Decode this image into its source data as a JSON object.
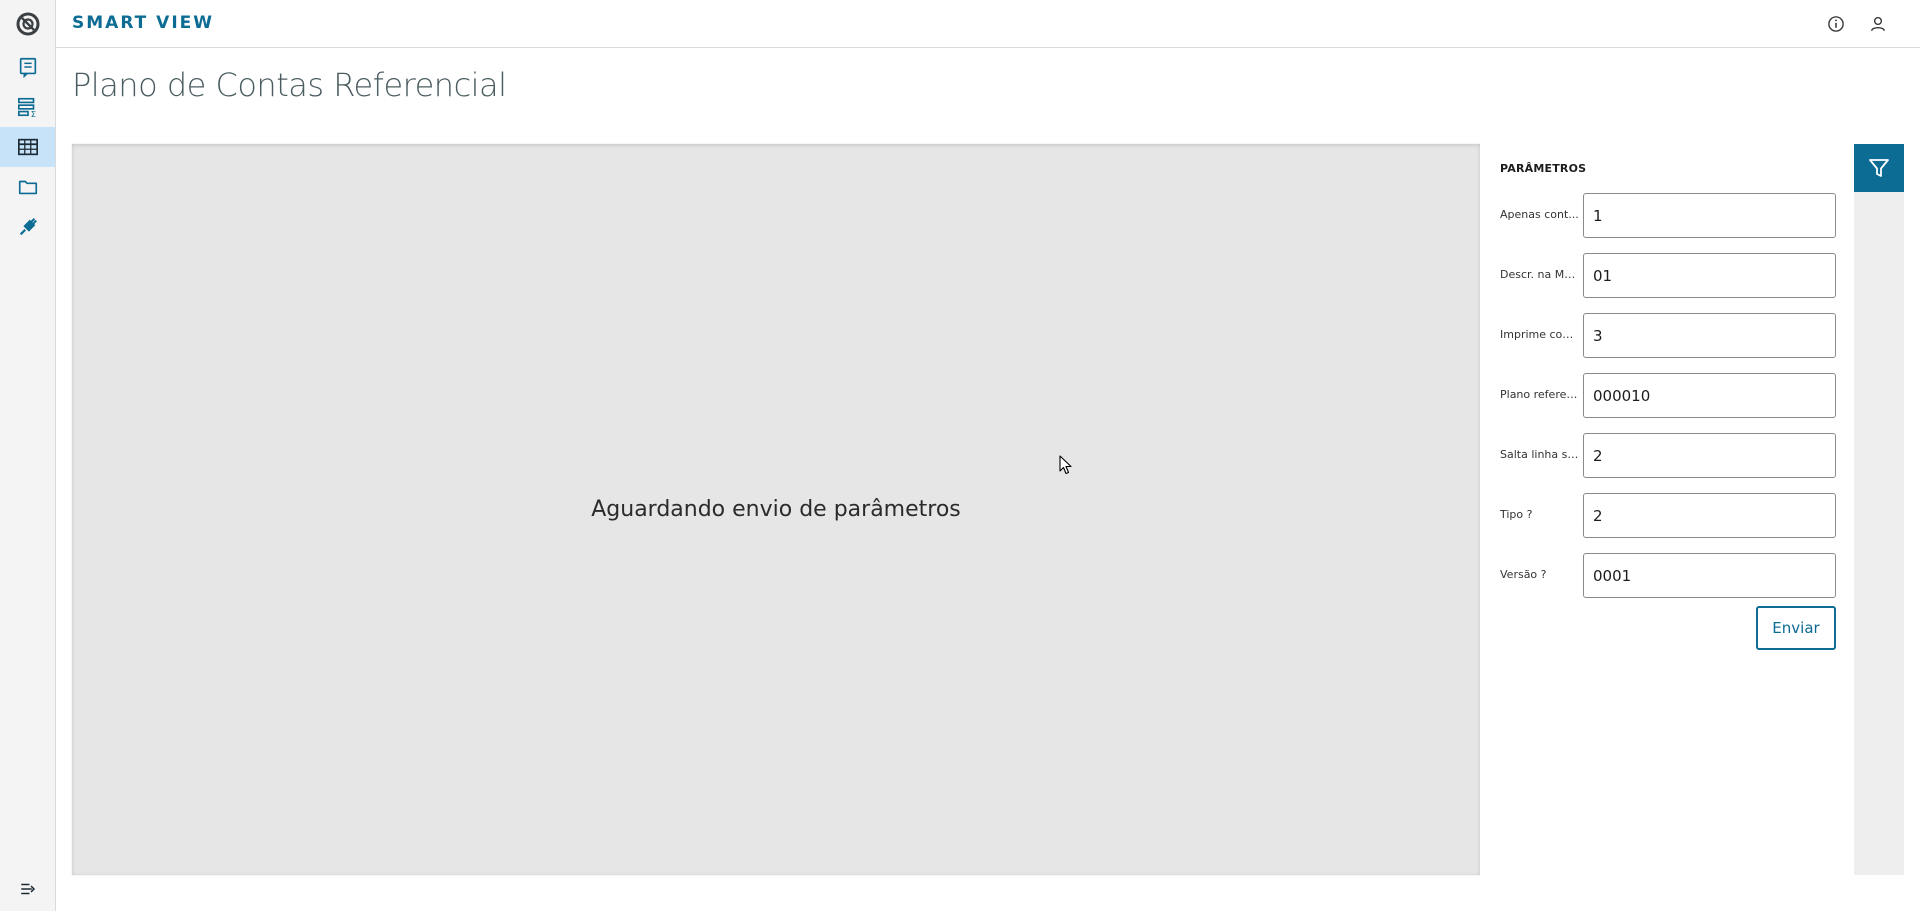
{
  "app": {
    "title": "SMART VIEW"
  },
  "sidebar": {
    "items": [
      {
        "name": "reports",
        "icon": "report-icon",
        "active": false
      },
      {
        "name": "analysis",
        "icon": "sum-table-icon",
        "active": false
      },
      {
        "name": "grid",
        "icon": "grid-table-icon",
        "active": true
      },
      {
        "name": "files",
        "icon": "folder-icon",
        "active": false
      },
      {
        "name": "plugins",
        "icon": "plug-icon",
        "active": false
      }
    ],
    "collapse_icon": "menu-expand-icon"
  },
  "header": {
    "info_icon": "info-icon",
    "user_icon": "user-icon"
  },
  "page": {
    "title": "Plano de Contas Referencial"
  },
  "result": {
    "message": "Aguardando envio de parâmetros"
  },
  "params": {
    "title": "PARÂMETROS",
    "fields": [
      {
        "label": "Apenas cont...",
        "value": "1"
      },
      {
        "label": "Descr. na Mo...",
        "value": "01"
      },
      {
        "label": "Imprime cont...",
        "value": "3"
      },
      {
        "label": "Plano referen...",
        "value": "000010"
      },
      {
        "label": "Salta linha si...",
        "value": "2"
      },
      {
        "label": "Tipo ?",
        "value": "2"
      },
      {
        "label": "Versão ?",
        "value": "0001"
      }
    ],
    "submit_label": "Enviar"
  },
  "colors": {
    "brand": "#0c6c94",
    "active_nav": "#c6e3fa",
    "result_bg": "#e6e6e6"
  }
}
